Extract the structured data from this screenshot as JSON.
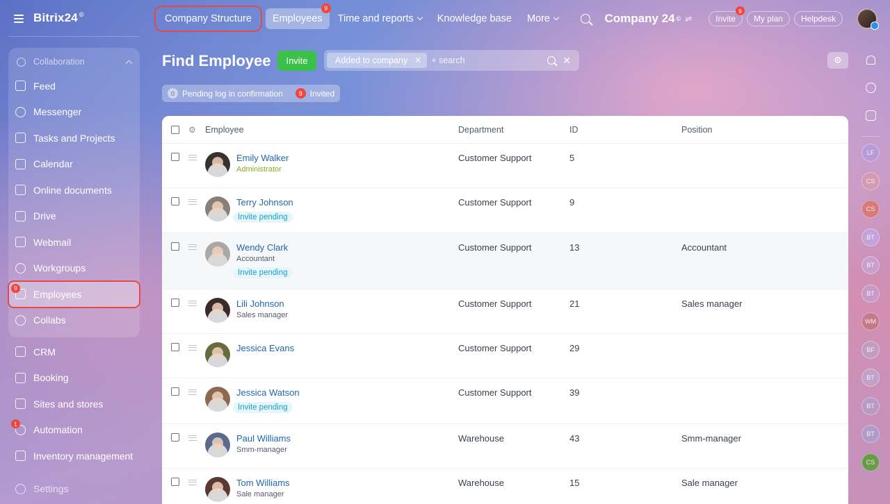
{
  "sidebar": {
    "brand": "Bitrix24",
    "brand_mark": "©",
    "group_label": "Collaboration",
    "group_items": [
      {
        "name": "feed",
        "label": "Feed",
        "icon": "feed-icon",
        "shape": "ib"
      },
      {
        "name": "messenger",
        "label": "Messenger",
        "icon": "chat-icon",
        "shape": "ic"
      },
      {
        "name": "tasks",
        "label": "Tasks and Projects",
        "icon": "task-checkbox-icon",
        "shape": "ib"
      },
      {
        "name": "calendar",
        "label": "Calendar",
        "icon": "calendar-icon",
        "shape": "ib"
      },
      {
        "name": "online-documents",
        "label": "Online documents",
        "icon": "document-icon",
        "shape": "ib"
      },
      {
        "name": "drive",
        "label": "Drive",
        "icon": "drive-icon",
        "shape": "ib"
      },
      {
        "name": "webmail",
        "label": "Webmail",
        "icon": "mail-icon",
        "shape": "ib"
      },
      {
        "name": "workgroups",
        "label": "Workgroups",
        "icon": "group-icon",
        "shape": "ic"
      },
      {
        "name": "employees",
        "label": "Employees",
        "icon": "employees-icon",
        "shape": "ib",
        "badge": "9",
        "active": true
      },
      {
        "name": "collabs",
        "label": "Collabs",
        "icon": "collabs-icon",
        "shape": "ic"
      }
    ],
    "items": [
      {
        "name": "crm",
        "label": "CRM",
        "icon": "crm-icon",
        "shape": "ib"
      },
      {
        "name": "booking",
        "label": "Booking",
        "icon": "booking-icon",
        "shape": "ib"
      },
      {
        "name": "sites",
        "label": "Sites and stores",
        "icon": "cart-icon",
        "shape": "ib"
      },
      {
        "name": "automation",
        "label": "Automation",
        "icon": "automation-icon",
        "shape": "ic",
        "badge": "1"
      },
      {
        "name": "inventory",
        "label": "Inventory management",
        "icon": "warehouse-icon",
        "shape": "ib"
      }
    ],
    "settings_label": "Settings"
  },
  "topnav": {
    "items": [
      {
        "name": "company-structure",
        "label": "Company Structure",
        "highlight": true
      },
      {
        "name": "employees",
        "label": "Employees",
        "selected": true,
        "badge": "9"
      },
      {
        "name": "time-reports",
        "label": "Time and reports",
        "dropdown": true
      },
      {
        "name": "knowledge-base",
        "label": "Knowledge base"
      },
      {
        "name": "more",
        "label": "More",
        "dropdown": true
      }
    ],
    "company_name": "Company 24",
    "company_mark": "©",
    "invite_label": "Invite",
    "invite_badge": "9",
    "plan_label": "My plan",
    "helpdesk_label": "Helpdesk"
  },
  "page": {
    "title": "Find Employee",
    "invite_button": "Invite",
    "filter_chip": "Added to company",
    "search_placeholder": "+ search",
    "counters": [
      {
        "name": "pending-confirmation",
        "count": "0",
        "label": "Pending log in confirmation",
        "style": "grey"
      },
      {
        "name": "invited",
        "count": "9",
        "label": "Invited",
        "style": "red"
      }
    ]
  },
  "table": {
    "columns": {
      "employee": "Employee",
      "department": "Department",
      "id": "ID",
      "position": "Position"
    },
    "rows": [
      {
        "name": "Emily Walker",
        "sub": "Administrator",
        "sub_style": "admin",
        "tag": "",
        "department": "Customer Support",
        "id": "5",
        "position": "",
        "height": 64,
        "avatar": "#3a3030"
      },
      {
        "name": "Terry Johnson",
        "sub": "",
        "tag": "Invite pending",
        "department": "Customer Support",
        "id": "9",
        "position": "",
        "height": 65,
        "avatar": "#8a7f78"
      },
      {
        "name": "Wendy Clark",
        "sub": "Accountant",
        "tag": "Invite pending",
        "department": "Customer Support",
        "id": "13",
        "position": "Accountant",
        "height": 81,
        "avatar": "#a9a7a8",
        "hover": true
      },
      {
        "name": "Lili Johnson",
        "sub": "Sales manager",
        "tag": "",
        "department": "Customer Support",
        "id": "21",
        "position": "Sales manager",
        "height": 64,
        "avatar": "#3b2b28"
      },
      {
        "name": "Jessica Evans",
        "sub": "",
        "tag": "",
        "department": "Customer Support",
        "id": "29",
        "position": "",
        "height": 64,
        "avatar": "#6b6a3d"
      },
      {
        "name": "Jessica Watson",
        "sub": "",
        "tag": "Invite pending",
        "department": "Customer Support",
        "id": "39",
        "position": "",
        "height": 66,
        "avatar": "#8b6a50"
      },
      {
        "name": "Paul Williams",
        "sub": "Smm-manager",
        "tag": "",
        "department": "Warehouse",
        "id": "43",
        "position": "Smm-manager",
        "height": 64,
        "avatar": "#5a6a8a"
      },
      {
        "name": "Tom Williams",
        "sub": "Sale manager",
        "tag": "",
        "department": "Warehouse",
        "id": "15",
        "position": "Sale manager",
        "height": 70,
        "avatar": "#5a3a30"
      }
    ]
  },
  "rail": {
    "avatars": [
      {
        "initials": "LF",
        "color": "#b79ad6"
      },
      {
        "initials": "CS",
        "color": "#d49ab0"
      },
      {
        "initials": "CS",
        "color": "#d77a7a"
      },
      {
        "initials": "BT",
        "color": "#c4a3d8"
      },
      {
        "initials": "BT",
        "color": "#c9a0cc"
      },
      {
        "initials": "BT",
        "color": "#c89ac8"
      },
      {
        "initials": "WM",
        "color": "#c57a8a"
      },
      {
        "initials": "BF",
        "color": "#c39dc0"
      },
      {
        "initials": "BT",
        "color": "#c2a0c8"
      },
      {
        "initials": "BT",
        "color": "#b89ac4"
      },
      {
        "initials": "BT",
        "color": "#b19bc8"
      },
      {
        "initials": "CS",
        "color": "#6a9a4a"
      }
    ]
  }
}
